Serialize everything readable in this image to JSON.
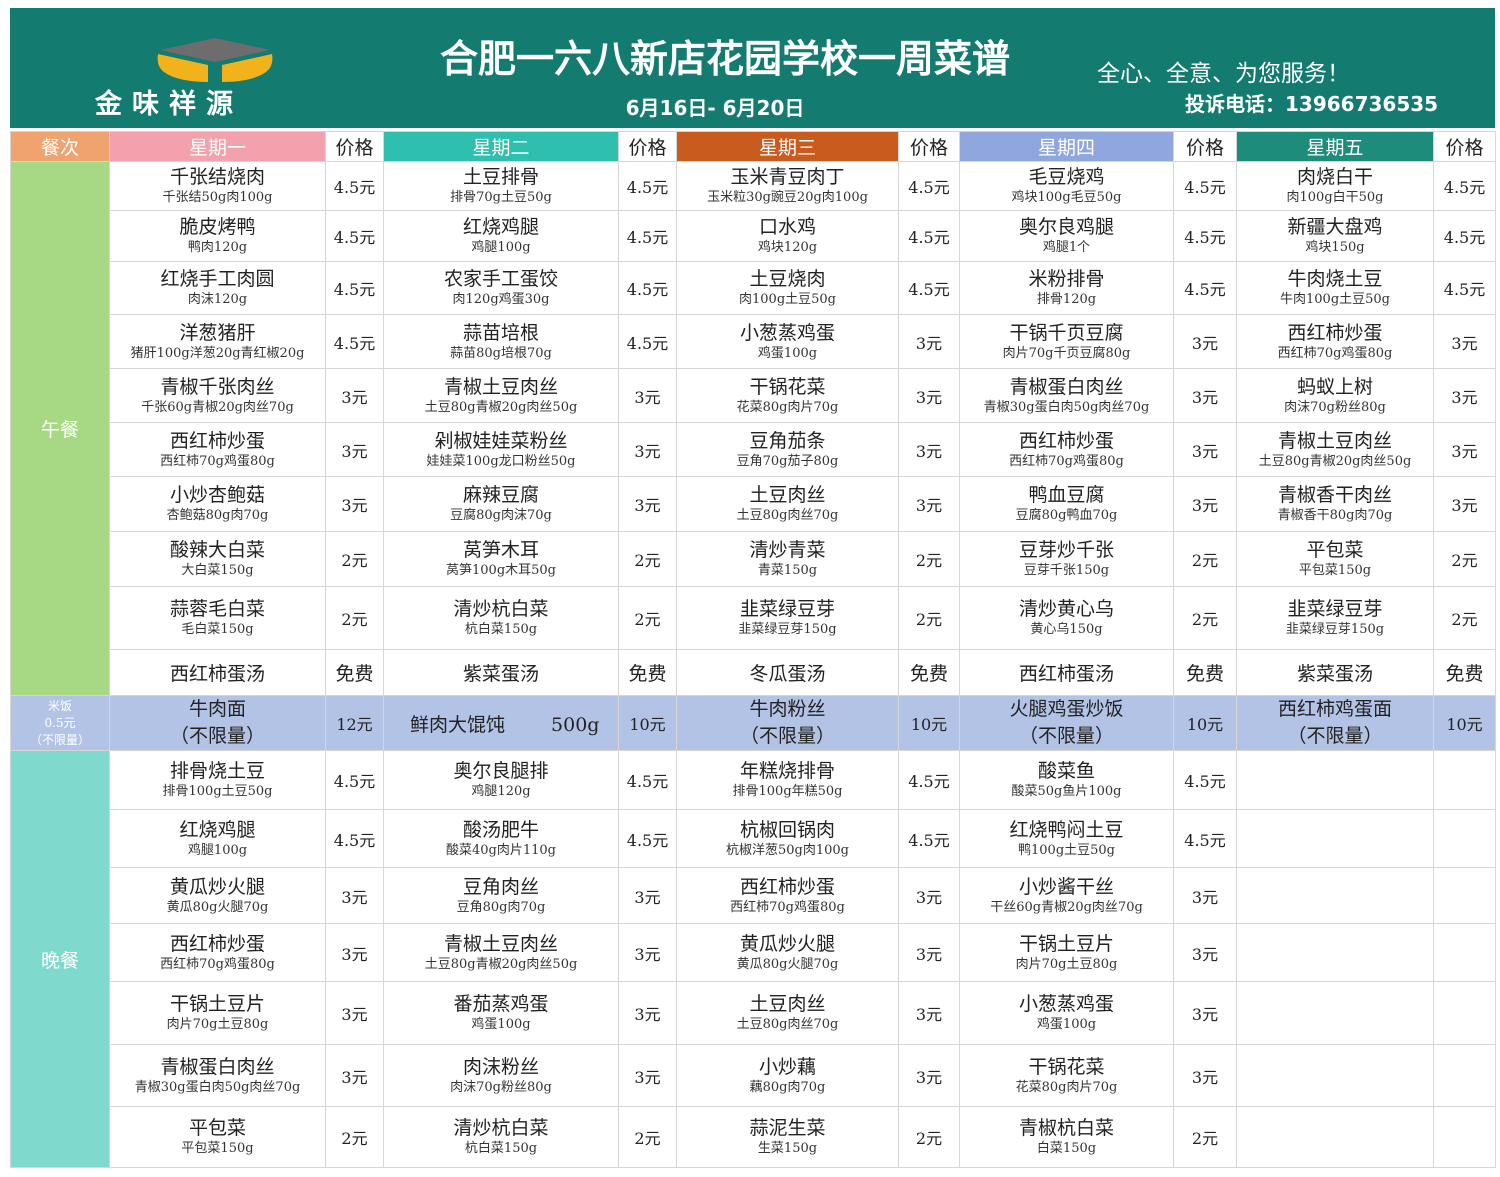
{
  "header": {
    "logo_text": "金味祥源",
    "title": "合肥一六八新店花园学校一周菜谱",
    "date_range": "6月16日- 6月20日",
    "slogan": "全心、全意、为您服务！",
    "complaint_phone": "投诉电话：13966736535"
  },
  "colors": {
    "header_bg": "#137b6f",
    "lunch": "#a7d884",
    "rice": "#b3c3e6",
    "dinner": "#7fd9cd"
  },
  "columns": {
    "meal": "餐次",
    "monday": "星期一",
    "tuesday": "星期二",
    "wednesday": "星期三",
    "thursday": "星期四",
    "friday": "星期五",
    "price": "价格"
  },
  "lunch": {
    "label": "午餐",
    "rows": [
      [
        [
          "千张结烧肉",
          "千张结50g肉100g",
          "4.5元"
        ],
        [
          "土豆排骨",
          "排骨70g土豆50g",
          "4.5元"
        ],
        [
          "玉米青豆肉丁",
          "玉米粒30g豌豆20g肉100g",
          "4.5元"
        ],
        [
          "毛豆烧鸡",
          "鸡块100g毛豆50g",
          "4.5元"
        ],
        [
          "肉烧白干",
          "肉100g白干50g",
          "4.5元"
        ]
      ],
      [
        [
          "脆皮烤鸭",
          "鸭肉120g",
          "4.5元"
        ],
        [
          "红烧鸡腿",
          "鸡腿100g",
          "4.5元"
        ],
        [
          "口水鸡",
          "鸡块120g",
          "4.5元"
        ],
        [
          "奥尔良鸡腿",
          "鸡腿1个",
          "4.5元"
        ],
        [
          "新疆大盘鸡",
          "鸡块150g",
          "4.5元"
        ]
      ],
      [
        [
          "红烧手工肉圆",
          "肉沫120g",
          "4.5元"
        ],
        [
          "农家手工蛋饺",
          "肉120g鸡蛋30g",
          "4.5元"
        ],
        [
          "土豆烧肉",
          "肉100g土豆50g",
          "4.5元"
        ],
        [
          "米粉排骨",
          "排骨120g",
          "4.5元"
        ],
        [
          "牛肉烧土豆",
          "牛肉100g土豆50g",
          "4.5元"
        ]
      ],
      [
        [
          "洋葱猪肝",
          "猪肝100g洋葱20g青红椒20g",
          "4.5元"
        ],
        [
          "蒜苗培根",
          "蒜苗80g培根70g",
          "4.5元"
        ],
        [
          "小葱蒸鸡蛋",
          "鸡蛋100g",
          "3元"
        ],
        [
          "干锅千页豆腐",
          "肉片70g千页豆腐80g",
          "3元"
        ],
        [
          "西红柿炒蛋",
          "西红柿70g鸡蛋80g",
          "3元"
        ]
      ],
      [
        [
          "青椒千张肉丝",
          "千张60g青椒20g肉丝70g",
          "3元"
        ],
        [
          "青椒土豆肉丝",
          "土豆80g青椒20g肉丝50g",
          "3元"
        ],
        [
          "干锅花菜",
          "花菜80g肉片70g",
          "3元"
        ],
        [
          "青椒蛋白肉丝",
          "青椒30g蛋白肉50g肉丝70g",
          "3元"
        ],
        [
          "蚂蚁上树",
          "肉沫70g粉丝80g",
          "3元"
        ]
      ],
      [
        [
          "西红柿炒蛋",
          "西红柿70g鸡蛋80g",
          "3元"
        ],
        [
          "剁椒娃娃菜粉丝",
          "娃娃菜100g龙口粉丝50g",
          "3元"
        ],
        [
          "豆角茄条",
          "豆角70g茄子80g",
          "3元"
        ],
        [
          "西红柿炒蛋",
          "西红柿70g鸡蛋80g",
          "3元"
        ],
        [
          "青椒土豆肉丝",
          "土豆80g青椒20g肉丝50g",
          "3元"
        ]
      ],
      [
        [
          "小炒杏鲍菇",
          "杏鲍菇80g肉70g",
          "3元"
        ],
        [
          "麻辣豆腐",
          "豆腐80g肉沫70g",
          "3元"
        ],
        [
          "土豆肉丝",
          "土豆80g肉丝70g",
          "3元"
        ],
        [
          "鸭血豆腐",
          "豆腐80g鸭血70g",
          "3元"
        ],
        [
          "青椒香干肉丝",
          "青椒香干80g肉70g",
          "3元"
        ]
      ],
      [
        [
          "酸辣大白菜",
          "大白菜150g",
          "2元"
        ],
        [
          "莴笋木耳",
          "莴笋100g木耳50g",
          "2元"
        ],
        [
          "清炒青菜",
          "青菜150g",
          "2元"
        ],
        [
          "豆芽炒千张",
          "豆芽千张150g",
          "2元"
        ],
        [
          "平包菜",
          "平包菜150g",
          "2元"
        ]
      ],
      [
        [
          "蒜蓉毛白菜",
          "毛白菜150g",
          "2元"
        ],
        [
          "清炒杭白菜",
          "杭白菜150g",
          "2元"
        ],
        [
          "韭菜绿豆芽",
          "韭菜绿豆芽150g",
          "2元"
        ],
        [
          "清炒黄心乌",
          "黄心乌150g",
          "2元"
        ],
        [
          "韭菜绿豆芽",
          "韭菜绿豆芽150g",
          "2元"
        ]
      ]
    ],
    "soups": [
      [
        "西红柿蛋汤",
        "免费"
      ],
      [
        "紫菜蛋汤",
        "免费"
      ],
      [
        "冬瓜蛋汤",
        "免费"
      ],
      [
        "西红柿蛋汤",
        "免费"
      ],
      [
        "紫菜蛋汤",
        "免费"
      ]
    ]
  },
  "rice": {
    "label_l1": "米饭",
    "label_l2": "0.5元",
    "label_l3": "（不限量）",
    "mon_name": "牛肉面",
    "mon_note": "（不限量）",
    "mon_price": "12元",
    "tue_name": "鲜肉大馄饨",
    "tue_weight": "500g",
    "tue_price": "10元",
    "wed_name": "牛肉粉丝",
    "wed_note": "（不限量）",
    "wed_price": "10元",
    "thu_name": "火腿鸡蛋炒饭",
    "thu_note": "（不限量）",
    "thu_price": "10元",
    "fri_name": "西红柿鸡蛋面",
    "fri_note": "（不限量）",
    "fri_price": "10元"
  },
  "dinner": {
    "label": "晚餐",
    "rows": [
      [
        [
          "排骨烧土豆",
          "排骨100g土豆50g",
          "4.5元"
        ],
        [
          "奥尔良腿排",
          "鸡腿120g",
          "4.5元"
        ],
        [
          "年糕烧排骨",
          "排骨100g年糕50g",
          "4.5元"
        ],
        [
          "酸菜鱼",
          "酸菜50g鱼片100g",
          "4.5元"
        ]
      ],
      [
        [
          "红烧鸡腿",
          "鸡腿100g",
          "4.5元"
        ],
        [
          "酸汤肥牛",
          "酸菜40g肉片110g",
          "4.5元"
        ],
        [
          "杭椒回锅肉",
          "杭椒洋葱50g肉100g",
          "4.5元"
        ],
        [
          "红烧鸭闷土豆",
          "鸭100g土豆50g",
          "4.5元"
        ]
      ],
      [
        [
          "黄瓜炒火腿",
          "黄瓜80g火腿70g",
          "3元"
        ],
        [
          "豆角肉丝",
          "豆角80g肉70g",
          "3元"
        ],
        [
          "西红柿炒蛋",
          "西红柿70g鸡蛋80g",
          "3元"
        ],
        [
          "小炒酱干丝",
          "干丝60g青椒20g肉丝70g",
          "3元"
        ]
      ],
      [
        [
          "西红柿炒蛋",
          "西红柿70g鸡蛋80g",
          "3元"
        ],
        [
          "青椒土豆肉丝",
          "土豆80g青椒20g肉丝50g",
          "3元"
        ],
        [
          "黄瓜炒火腿",
          "黄瓜80g火腿70g",
          "3元"
        ],
        [
          "干锅土豆片",
          "肉片70g土豆80g",
          "3元"
        ]
      ],
      [
        [
          "干锅土豆片",
          "肉片70g土豆80g",
          "3元"
        ],
        [
          "番茄蒸鸡蛋",
          "鸡蛋100g",
          "3元"
        ],
        [
          "土豆肉丝",
          "土豆80g肉丝70g",
          "3元"
        ],
        [
          "小葱蒸鸡蛋",
          "鸡蛋100g",
          "3元"
        ]
      ],
      [
        [
          "青椒蛋白肉丝",
          "青椒30g蛋白肉50g肉丝70g",
          "3元"
        ],
        [
          "肉沫粉丝",
          "肉沫70g粉丝80g",
          "3元"
        ],
        [
          "小炒藕",
          "藕80g肉70g",
          "3元"
        ],
        [
          "干锅花菜",
          "花菜80g肉片70g",
          "3元"
        ]
      ],
      [
        [
          "平包菜",
          "平包菜150g",
          "2元"
        ],
        [
          "清炒杭白菜",
          "杭白菜150g",
          "2元"
        ],
        [
          "蒜泥生菜",
          "生菜150g",
          "2元"
        ],
        [
          "青椒杭白菜",
          "白菜150g",
          "2元"
        ]
      ]
    ]
  }
}
